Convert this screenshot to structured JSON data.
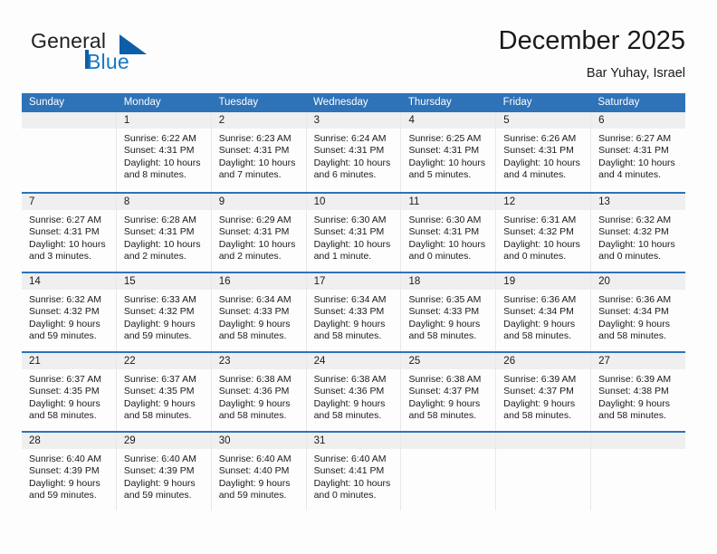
{
  "brand": {
    "name_part1": "General",
    "name_part2": "Blue"
  },
  "header": {
    "title": "December 2025",
    "location": "Bar Yuhay, Israel"
  },
  "colors": {
    "header_blue": "#2e72b8",
    "brand_blue": "#1878c4",
    "triangle_blue": "#0b5ea8",
    "day_band_gray": "#efefef",
    "page_background": "#fdfdfd"
  },
  "weekdays": [
    "Sunday",
    "Monday",
    "Tuesday",
    "Wednesday",
    "Thursday",
    "Friday",
    "Saturday"
  ],
  "weeks": [
    [
      {
        "day": "",
        "sunrise": "",
        "sunset": "",
        "daylight_line1": "",
        "daylight_line2": ""
      },
      {
        "day": "1",
        "sunrise": "Sunrise: 6:22 AM",
        "sunset": "Sunset: 4:31 PM",
        "daylight_line1": "Daylight: 10 hours",
        "daylight_line2": "and 8 minutes."
      },
      {
        "day": "2",
        "sunrise": "Sunrise: 6:23 AM",
        "sunset": "Sunset: 4:31 PM",
        "daylight_line1": "Daylight: 10 hours",
        "daylight_line2": "and 7 minutes."
      },
      {
        "day": "3",
        "sunrise": "Sunrise: 6:24 AM",
        "sunset": "Sunset: 4:31 PM",
        "daylight_line1": "Daylight: 10 hours",
        "daylight_line2": "and 6 minutes."
      },
      {
        "day": "4",
        "sunrise": "Sunrise: 6:25 AM",
        "sunset": "Sunset: 4:31 PM",
        "daylight_line1": "Daylight: 10 hours",
        "daylight_line2": "and 5 minutes."
      },
      {
        "day": "5",
        "sunrise": "Sunrise: 6:26 AM",
        "sunset": "Sunset: 4:31 PM",
        "daylight_line1": "Daylight: 10 hours",
        "daylight_line2": "and 4 minutes."
      },
      {
        "day": "6",
        "sunrise": "Sunrise: 6:27 AM",
        "sunset": "Sunset: 4:31 PM",
        "daylight_line1": "Daylight: 10 hours",
        "daylight_line2": "and 4 minutes."
      }
    ],
    [
      {
        "day": "7",
        "sunrise": "Sunrise: 6:27 AM",
        "sunset": "Sunset: 4:31 PM",
        "daylight_line1": "Daylight: 10 hours",
        "daylight_line2": "and 3 minutes."
      },
      {
        "day": "8",
        "sunrise": "Sunrise: 6:28 AM",
        "sunset": "Sunset: 4:31 PM",
        "daylight_line1": "Daylight: 10 hours",
        "daylight_line2": "and 2 minutes."
      },
      {
        "day": "9",
        "sunrise": "Sunrise: 6:29 AM",
        "sunset": "Sunset: 4:31 PM",
        "daylight_line1": "Daylight: 10 hours",
        "daylight_line2": "and 2 minutes."
      },
      {
        "day": "10",
        "sunrise": "Sunrise: 6:30 AM",
        "sunset": "Sunset: 4:31 PM",
        "daylight_line1": "Daylight: 10 hours",
        "daylight_line2": "and 1 minute."
      },
      {
        "day": "11",
        "sunrise": "Sunrise: 6:30 AM",
        "sunset": "Sunset: 4:31 PM",
        "daylight_line1": "Daylight: 10 hours",
        "daylight_line2": "and 0 minutes."
      },
      {
        "day": "12",
        "sunrise": "Sunrise: 6:31 AM",
        "sunset": "Sunset: 4:32 PM",
        "daylight_line1": "Daylight: 10 hours",
        "daylight_line2": "and 0 minutes."
      },
      {
        "day": "13",
        "sunrise": "Sunrise: 6:32 AM",
        "sunset": "Sunset: 4:32 PM",
        "daylight_line1": "Daylight: 10 hours",
        "daylight_line2": "and 0 minutes."
      }
    ],
    [
      {
        "day": "14",
        "sunrise": "Sunrise: 6:32 AM",
        "sunset": "Sunset: 4:32 PM",
        "daylight_line1": "Daylight: 9 hours",
        "daylight_line2": "and 59 minutes."
      },
      {
        "day": "15",
        "sunrise": "Sunrise: 6:33 AM",
        "sunset": "Sunset: 4:32 PM",
        "daylight_line1": "Daylight: 9 hours",
        "daylight_line2": "and 59 minutes."
      },
      {
        "day": "16",
        "sunrise": "Sunrise: 6:34 AM",
        "sunset": "Sunset: 4:33 PM",
        "daylight_line1": "Daylight: 9 hours",
        "daylight_line2": "and 58 minutes."
      },
      {
        "day": "17",
        "sunrise": "Sunrise: 6:34 AM",
        "sunset": "Sunset: 4:33 PM",
        "daylight_line1": "Daylight: 9 hours",
        "daylight_line2": "and 58 minutes."
      },
      {
        "day": "18",
        "sunrise": "Sunrise: 6:35 AM",
        "sunset": "Sunset: 4:33 PM",
        "daylight_line1": "Daylight: 9 hours",
        "daylight_line2": "and 58 minutes."
      },
      {
        "day": "19",
        "sunrise": "Sunrise: 6:36 AM",
        "sunset": "Sunset: 4:34 PM",
        "daylight_line1": "Daylight: 9 hours",
        "daylight_line2": "and 58 minutes."
      },
      {
        "day": "20",
        "sunrise": "Sunrise: 6:36 AM",
        "sunset": "Sunset: 4:34 PM",
        "daylight_line1": "Daylight: 9 hours",
        "daylight_line2": "and 58 minutes."
      }
    ],
    [
      {
        "day": "21",
        "sunrise": "Sunrise: 6:37 AM",
        "sunset": "Sunset: 4:35 PM",
        "daylight_line1": "Daylight: 9 hours",
        "daylight_line2": "and 58 minutes."
      },
      {
        "day": "22",
        "sunrise": "Sunrise: 6:37 AM",
        "sunset": "Sunset: 4:35 PM",
        "daylight_line1": "Daylight: 9 hours",
        "daylight_line2": "and 58 minutes."
      },
      {
        "day": "23",
        "sunrise": "Sunrise: 6:38 AM",
        "sunset": "Sunset: 4:36 PM",
        "daylight_line1": "Daylight: 9 hours",
        "daylight_line2": "and 58 minutes."
      },
      {
        "day": "24",
        "sunrise": "Sunrise: 6:38 AM",
        "sunset": "Sunset: 4:36 PM",
        "daylight_line1": "Daylight: 9 hours",
        "daylight_line2": "and 58 minutes."
      },
      {
        "day": "25",
        "sunrise": "Sunrise: 6:38 AM",
        "sunset": "Sunset: 4:37 PM",
        "daylight_line1": "Daylight: 9 hours",
        "daylight_line2": "and 58 minutes."
      },
      {
        "day": "26",
        "sunrise": "Sunrise: 6:39 AM",
        "sunset": "Sunset: 4:37 PM",
        "daylight_line1": "Daylight: 9 hours",
        "daylight_line2": "and 58 minutes."
      },
      {
        "day": "27",
        "sunrise": "Sunrise: 6:39 AM",
        "sunset": "Sunset: 4:38 PM",
        "daylight_line1": "Daylight: 9 hours",
        "daylight_line2": "and 58 minutes."
      }
    ],
    [
      {
        "day": "28",
        "sunrise": "Sunrise: 6:40 AM",
        "sunset": "Sunset: 4:39 PM",
        "daylight_line1": "Daylight: 9 hours",
        "daylight_line2": "and 59 minutes."
      },
      {
        "day": "29",
        "sunrise": "Sunrise: 6:40 AM",
        "sunset": "Sunset: 4:39 PM",
        "daylight_line1": "Daylight: 9 hours",
        "daylight_line2": "and 59 minutes."
      },
      {
        "day": "30",
        "sunrise": "Sunrise: 6:40 AM",
        "sunset": "Sunset: 4:40 PM",
        "daylight_line1": "Daylight: 9 hours",
        "daylight_line2": "and 59 minutes."
      },
      {
        "day": "31",
        "sunrise": "Sunrise: 6:40 AM",
        "sunset": "Sunset: 4:41 PM",
        "daylight_line1": "Daylight: 10 hours",
        "daylight_line2": "and 0 minutes."
      },
      {
        "day": "",
        "sunrise": "",
        "sunset": "",
        "daylight_line1": "",
        "daylight_line2": ""
      },
      {
        "day": "",
        "sunrise": "",
        "sunset": "",
        "daylight_line1": "",
        "daylight_line2": ""
      },
      {
        "day": "",
        "sunrise": "",
        "sunset": "",
        "daylight_line1": "",
        "daylight_line2": ""
      }
    ]
  ]
}
